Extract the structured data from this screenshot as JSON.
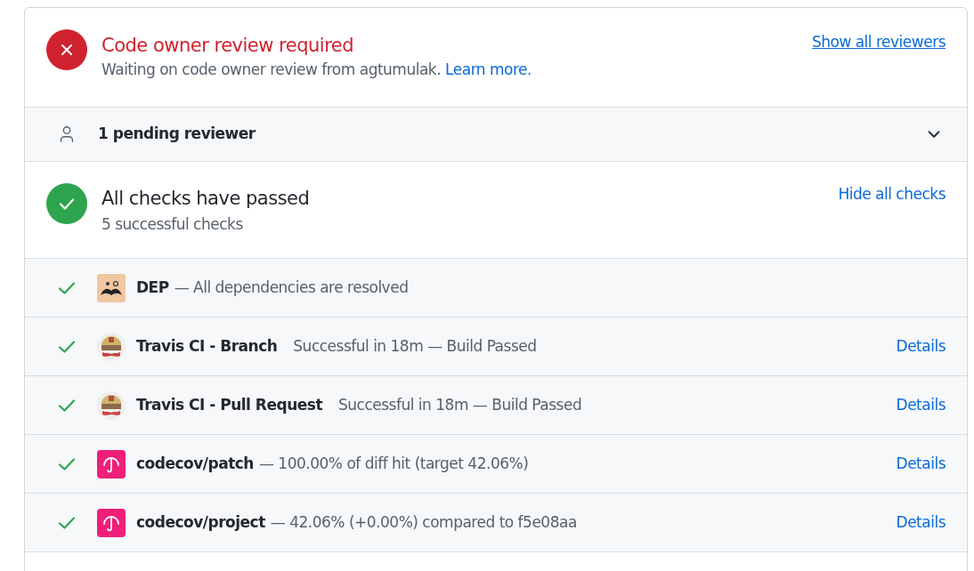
{
  "review": {
    "passed": false,
    "title": "Code owner review required",
    "message": "Waiting on code owner review from agtumulak.",
    "link": "Learn more.",
    "action": "Show all reviewers"
  },
  "pending": {
    "label": "1 pending reviewer",
    "expanded": false
  },
  "checks_summary": {
    "passed": true,
    "title": "All checks have passed",
    "subtitle": "5 successful checks",
    "action": "Hide all checks"
  },
  "checks": [
    {
      "kind": "dep",
      "passed": true,
      "name": "DEP",
      "description": "— All dependencies are resolved"
    },
    {
      "kind": "travis",
      "passed": true,
      "name": "Travis CI - Branch",
      "description": "Successful in 18m — Build Passed",
      "link": "Details"
    },
    {
      "kind": "travis",
      "passed": true,
      "name": "Travis CI - Pull Request",
      "description": "Successful in 18m — Build Passed",
      "link": "Details"
    },
    {
      "kind": "codecov",
      "passed": true,
      "name": "codecov/patch",
      "description": "— 100.00% of diff hit (target 42.06%)",
      "link": "Details"
    },
    {
      "kind": "codecov",
      "passed": true,
      "name": "codecov/project",
      "description": "— 42.06% (+0.00%) compared to f5e08aa",
      "link": "Details"
    }
  ]
}
